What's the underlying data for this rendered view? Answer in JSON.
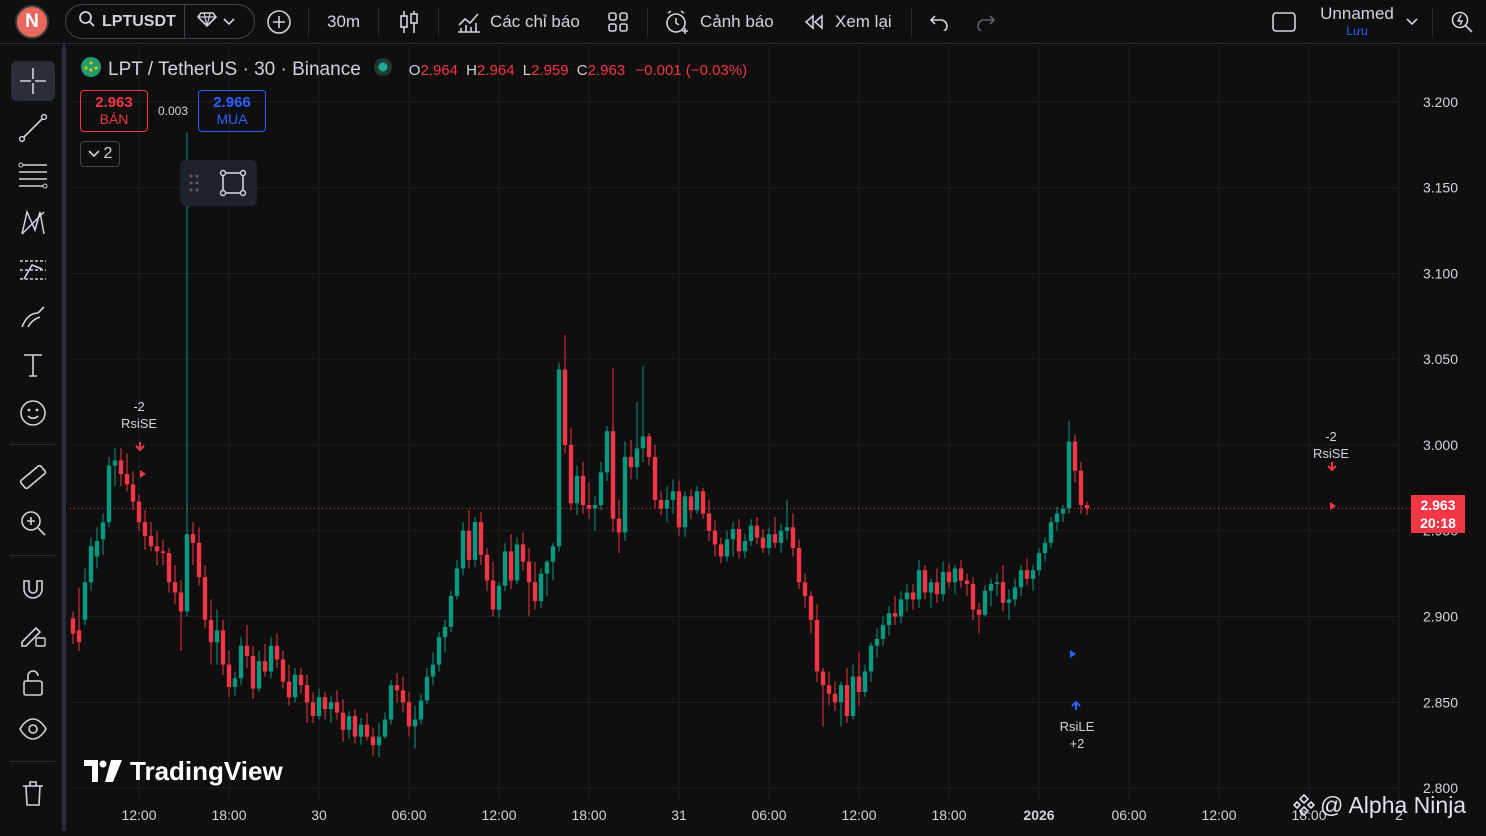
{
  "topbar": {
    "avatar_letter": "N",
    "symbol": "LPTUSDT",
    "interval": "30m",
    "indicators_label": "Các chỉ báo",
    "alerts_label": "Cảnh báo",
    "replay_label": "Xem lại",
    "layout_name": "Unnamed",
    "layout_status": "Lưu"
  },
  "legend": {
    "title": "LPT / TetherUS · 30 · Binance",
    "o_key": "O",
    "o_val": "2.964",
    "h_key": "H",
    "h_val": "2.964",
    "l_key": "L",
    "l_val": "2.959",
    "c_key": "C",
    "c_val": "2.963",
    "change": "−0.001 (−0.03%)"
  },
  "trade": {
    "sell_price": "2.963",
    "sell_label": "BÁN",
    "spread": "0.003",
    "buy_price": "2.966",
    "buy_label": "MUA",
    "collapse_count": "2"
  },
  "price_tag": {
    "price": "2.963",
    "countdown": "20:18"
  },
  "annotations": {
    "rsise_1_num": "-2",
    "rsise_1_label": "RsiSE",
    "rsise_2_num": "-2",
    "rsise_2_label": "RsiSE",
    "rsile_label": "RsiLE",
    "rsile_num": "+2"
  },
  "branding": {
    "logo_text": "TradingView",
    "watermark": "@ Alpha Ninja"
  },
  "colors": {
    "up": "#089981",
    "down": "#f23645",
    "bg": "#0f0f0f",
    "grid": "#1c1f26",
    "accent": "#2962ff"
  },
  "chart_data": {
    "type": "candlestick",
    "symbol": "LPT / TetherUS",
    "exchange": "Binance",
    "interval_minutes": 30,
    "y_ticks": [
      "3.200",
      "3.150",
      "3.100",
      "3.050",
      "3.000",
      "2.950",
      "2.900",
      "2.850",
      "2.800"
    ],
    "x_ticks": [
      "12:00",
      "18:00",
      "30",
      "06:00",
      "12:00",
      "18:00",
      "31",
      "06:00",
      "12:00",
      "18:00",
      "2026",
      "06:00",
      "12:00",
      "18:00",
      "2"
    ],
    "ylim": [
      2.7925,
      3.2325
    ],
    "last_price": 2.963,
    "ohlc": [
      [
        2.899,
        2.903,
        2.884,
        2.89
      ],
      [
        2.892,
        2.917,
        2.88,
        2.885
      ],
      [
        2.898,
        2.928,
        2.895,
        2.92
      ],
      [
        2.92,
        2.946,
        2.915,
        2.941
      ],
      [
        2.935,
        2.952,
        2.928,
        2.944
      ],
      [
        2.945,
        2.96,
        2.936,
        2.955
      ],
      [
        2.955,
        2.993,
        2.952,
        2.988
      ],
      [
        2.988,
        2.998,
        2.976,
        2.991
      ],
      [
        2.991,
        2.998,
        2.976,
        2.983
      ],
      [
        2.983,
        2.995,
        2.973,
        2.977
      ],
      [
        2.977,
        2.985,
        2.962,
        2.967
      ],
      [
        2.967,
        2.971,
        2.95,
        2.955
      ],
      [
        2.955,
        2.962,
        2.939,
        2.947
      ],
      [
        2.947,
        2.955,
        2.938,
        2.941
      ],
      [
        2.941,
        2.95,
        2.93,
        2.938
      ],
      [
        2.938,
        2.945,
        2.93,
        2.937
      ],
      [
        2.937,
        2.94,
        2.914,
        2.92
      ],
      [
        2.92,
        2.93,
        2.907,
        2.914
      ],
      [
        2.914,
        2.921,
        2.88,
        2.903
      ],
      [
        2.903,
        3.182,
        2.9,
        2.948
      ],
      [
        2.948,
        2.955,
        2.93,
        2.943
      ],
      [
        2.943,
        2.952,
        2.918,
        2.923
      ],
      [
        2.923,
        2.93,
        2.893,
        2.898
      ],
      [
        2.898,
        2.91,
        2.872,
        2.885
      ],
      [
        2.885,
        2.904,
        2.872,
        2.892
      ],
      [
        2.892,
        2.898,
        2.866,
        2.872
      ],
      [
        2.872,
        2.88,
        2.853,
        2.859
      ],
      [
        2.859,
        2.868,
        2.854,
        2.864
      ],
      [
        2.864,
        2.888,
        2.86,
        2.883
      ],
      [
        2.883,
        2.895,
        2.87,
        2.877
      ],
      [
        2.877,
        2.883,
        2.852,
        2.858
      ],
      [
        2.858,
        2.88,
        2.856,
        2.874
      ],
      [
        2.874,
        2.884,
        2.865,
        2.868
      ],
      [
        2.868,
        2.888,
        2.864,
        2.883
      ],
      [
        2.883,
        2.89,
        2.87,
        2.875
      ],
      [
        2.875,
        2.88,
        2.858,
        2.862
      ],
      [
        2.862,
        2.872,
        2.848,
        2.853
      ],
      [
        2.853,
        2.87,
        2.85,
        2.866
      ],
      [
        2.866,
        2.87,
        2.855,
        2.86
      ],
      [
        2.86,
        2.866,
        2.838,
        2.85
      ],
      [
        2.85,
        2.856,
        2.838,
        2.842
      ],
      [
        2.842,
        2.858,
        2.84,
        2.853
      ],
      [
        2.853,
        2.856,
        2.84,
        2.846
      ],
      [
        2.846,
        2.854,
        2.838,
        2.85
      ],
      [
        2.85,
        2.857,
        2.84,
        2.844
      ],
      [
        2.844,
        2.852,
        2.827,
        2.834
      ],
      [
        2.834,
        2.845,
        2.829,
        2.842
      ],
      [
        2.842,
        2.846,
        2.826,
        2.83
      ],
      [
        2.83,
        2.841,
        2.825,
        2.837
      ],
      [
        2.837,
        2.844,
        2.828,
        2.83
      ],
      [
        2.83,
        2.835,
        2.819,
        2.825
      ],
      [
        2.825,
        2.838,
        2.818,
        2.83
      ],
      [
        2.83,
        2.844,
        2.829,
        2.84
      ],
      [
        2.84,
        2.863,
        2.837,
        2.86
      ],
      [
        2.86,
        2.867,
        2.85,
        2.857
      ],
      [
        2.857,
        2.865,
        2.844,
        2.85
      ],
      [
        2.85,
        2.856,
        2.83,
        2.836
      ],
      [
        2.836,
        2.848,
        2.823,
        2.84
      ],
      [
        2.84,
        2.855,
        2.837,
        2.851
      ],
      [
        2.851,
        2.87,
        2.849,
        2.865
      ],
      [
        2.865,
        2.879,
        2.86,
        2.872
      ],
      [
        2.872,
        2.891,
        2.868,
        2.888
      ],
      [
        2.888,
        2.898,
        2.879,
        2.894
      ],
      [
        2.894,
        2.915,
        2.891,
        2.912
      ],
      [
        2.912,
        2.933,
        2.91,
        2.928
      ],
      [
        2.928,
        2.955,
        2.924,
        2.95
      ],
      [
        2.95,
        2.962,
        2.928,
        2.933
      ],
      [
        2.933,
        2.958,
        2.929,
        2.955
      ],
      [
        2.955,
        2.961,
        2.93,
        2.936
      ],
      [
        2.936,
        2.94,
        2.915,
        2.921
      ],
      [
        2.921,
        2.932,
        2.9,
        2.904
      ],
      [
        2.904,
        2.92,
        2.899,
        2.918
      ],
      [
        2.918,
        2.943,
        2.915,
        2.938
      ],
      [
        2.938,
        2.948,
        2.916,
        2.921
      ],
      [
        2.921,
        2.946,
        2.919,
        2.942
      ],
      [
        2.942,
        2.949,
        2.927,
        2.932
      ],
      [
        2.932,
        2.94,
        2.9,
        2.92
      ],
      [
        2.92,
        2.932,
        2.904,
        2.909
      ],
      [
        2.909,
        2.928,
        2.905,
        2.925
      ],
      [
        2.925,
        2.933,
        2.912,
        2.932
      ],
      [
        2.932,
        2.943,
        2.921,
        2.941
      ],
      [
        2.941,
        3.048,
        2.938,
        3.044
      ],
      [
        3.044,
        3.064,
        2.995,
        3.0
      ],
      [
        3.0,
        3.01,
        2.962,
        2.966
      ],
      [
        2.966,
        2.988,
        2.959,
        2.982
      ],
      [
        2.982,
        2.99,
        2.96,
        2.965
      ],
      [
        2.965,
        2.978,
        2.957,
        2.963
      ],
      [
        2.963,
        2.97,
        2.95,
        2.965
      ],
      [
        2.965,
        2.99,
        2.962,
        2.984
      ],
      [
        2.984,
        3.011,
        2.979,
        3.008
      ],
      [
        3.008,
        3.045,
        2.949,
        2.957
      ],
      [
        2.957,
        2.968,
        2.937,
        2.949
      ],
      [
        2.949,
        3.002,
        2.944,
        2.993
      ],
      [
        2.993,
        3.003,
        2.98,
        2.987
      ],
      [
        2.987,
        3.025,
        2.98,
        2.998
      ],
      [
        2.998,
        3.046,
        2.99,
        3.005
      ],
      [
        3.005,
        3.007,
        2.988,
        2.993
      ],
      [
        2.993,
        3.0,
        2.963,
        2.968
      ],
      [
        2.968,
        2.973,
        2.959,
        2.963
      ],
      [
        2.963,
        2.976,
        2.955,
        2.968
      ],
      [
        2.968,
        2.98,
        2.96,
        2.973
      ],
      [
        2.973,
        2.979,
        2.947,
        2.952
      ],
      [
        2.952,
        2.973,
        2.946,
        2.97
      ],
      [
        2.97,
        2.974,
        2.957,
        2.962
      ],
      [
        2.962,
        2.976,
        2.96,
        2.973
      ],
      [
        2.973,
        2.975,
        2.957,
        2.96
      ],
      [
        2.96,
        2.968,
        2.944,
        2.95
      ],
      [
        2.95,
        2.956,
        2.935,
        2.942
      ],
      [
        2.942,
        2.946,
        2.931,
        2.935
      ],
      [
        2.935,
        2.95,
        2.932,
        2.945
      ],
      [
        2.945,
        2.955,
        2.935,
        2.951
      ],
      [
        2.951,
        2.957,
        2.934,
        2.938
      ],
      [
        2.938,
        2.948,
        2.934,
        2.944
      ],
      [
        2.944,
        2.957,
        2.941,
        2.953
      ],
      [
        2.953,
        2.958,
        2.942,
        2.946
      ],
      [
        2.946,
        2.951,
        2.937,
        2.94
      ],
      [
        2.94,
        2.952,
        2.936,
        2.948
      ],
      [
        2.948,
        2.958,
        2.94,
        2.943
      ],
      [
        2.943,
        2.954,
        2.937,
        2.95
      ],
      [
        2.95,
        2.968,
        2.945,
        2.952
      ],
      [
        2.952,
        2.96,
        2.935,
        2.94
      ],
      [
        2.94,
        2.945,
        2.916,
        2.92
      ],
      [
        2.92,
        2.925,
        2.905,
        2.912
      ],
      [
        2.912,
        2.915,
        2.89,
        2.898
      ],
      [
        2.898,
        2.907,
        2.862,
        2.868
      ],
      [
        2.868,
        2.87,
        2.836,
        2.86
      ],
      [
        2.86,
        2.868,
        2.848,
        2.855
      ],
      [
        2.855,
        2.862,
        2.845,
        2.85
      ],
      [
        2.85,
        2.862,
        2.836,
        2.86
      ],
      [
        2.86,
        2.87,
        2.838,
        2.842
      ],
      [
        2.842,
        2.872,
        2.84,
        2.865
      ],
      [
        2.865,
        2.879,
        2.848,
        2.856
      ],
      [
        2.856,
        2.872,
        2.853,
        2.868
      ],
      [
        2.868,
        2.885,
        2.862,
        2.883
      ],
      [
        2.883,
        2.893,
        2.876,
        2.887
      ],
      [
        2.887,
        2.9,
        2.883,
        2.895
      ],
      [
        2.895,
        2.906,
        2.889,
        2.902
      ],
      [
        2.902,
        2.912,
        2.895,
        2.9
      ],
      [
        2.9,
        2.915,
        2.896,
        2.91
      ],
      [
        2.91,
        2.919,
        2.903,
        2.914
      ],
      [
        2.914,
        2.919,
        2.904,
        2.91
      ],
      [
        2.91,
        2.933,
        2.905,
        2.927
      ],
      [
        2.927,
        2.93,
        2.91,
        2.914
      ],
      [
        2.914,
        2.922,
        2.905,
        2.92
      ],
      [
        2.92,
        2.928,
        2.908,
        2.913
      ],
      [
        2.913,
        2.932,
        2.909,
        2.926
      ],
      [
        2.926,
        2.931,
        2.917,
        2.92
      ],
      [
        2.92,
        2.93,
        2.913,
        2.928
      ],
      [
        2.928,
        2.933,
        2.917,
        2.921
      ],
      [
        2.921,
        2.925,
        2.912,
        2.919
      ],
      [
        2.919,
        2.923,
        2.898,
        2.904
      ],
      [
        2.904,
        2.908,
        2.89,
        2.901
      ],
      [
        2.901,
        2.918,
        2.9,
        2.915
      ],
      [
        2.915,
        2.922,
        2.906,
        2.919
      ],
      [
        2.919,
        2.925,
        2.912,
        2.92
      ],
      [
        2.92,
        2.93,
        2.903,
        2.908
      ],
      [
        2.908,
        2.916,
        2.898,
        2.91
      ],
      [
        2.91,
        2.922,
        2.906,
        2.917
      ],
      [
        2.917,
        2.93,
        2.912,
        2.927
      ],
      [
        2.927,
        2.934,
        2.918,
        2.922
      ],
      [
        2.922,
        2.93,
        2.915,
        2.927
      ],
      [
        2.927,
        2.94,
        2.924,
        2.937
      ],
      [
        2.937,
        2.946,
        2.932,
        2.943
      ],
      [
        2.943,
        2.958,
        2.94,
        2.955
      ],
      [
        2.955,
        2.964,
        2.95,
        2.96
      ],
      [
        2.96,
        2.965,
        2.955,
        2.963
      ],
      [
        2.963,
        3.014,
        2.96,
        3.002
      ],
      [
        3.002,
        3.006,
        2.978,
        2.985
      ],
      [
        2.985,
        2.99,
        2.96,
        2.965
      ],
      [
        2.965,
        2.967,
        2.959,
        2.963
      ]
    ]
  }
}
